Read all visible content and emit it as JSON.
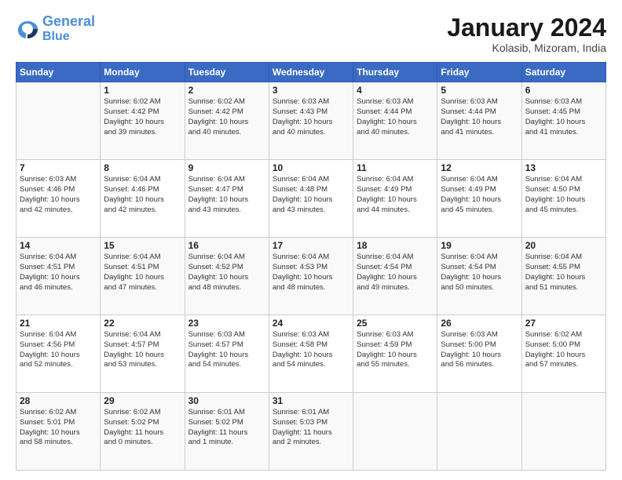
{
  "logo": {
    "line1": "General",
    "line2": "Blue"
  },
  "title": "January 2024",
  "location": "Kolasib, Mizoram, India",
  "weekdays": [
    "Sunday",
    "Monday",
    "Tuesday",
    "Wednesday",
    "Thursday",
    "Friday",
    "Saturday"
  ],
  "weeks": [
    [
      {
        "day": "",
        "info": ""
      },
      {
        "day": "1",
        "info": "Sunrise: 6:02 AM\nSunset: 4:42 PM\nDaylight: 10 hours\nand 39 minutes."
      },
      {
        "day": "2",
        "info": "Sunrise: 6:02 AM\nSunset: 4:42 PM\nDaylight: 10 hours\nand 40 minutes."
      },
      {
        "day": "3",
        "info": "Sunrise: 6:03 AM\nSunset: 4:43 PM\nDaylight: 10 hours\nand 40 minutes."
      },
      {
        "day": "4",
        "info": "Sunrise: 6:03 AM\nSunset: 4:44 PM\nDaylight: 10 hours\nand 40 minutes."
      },
      {
        "day": "5",
        "info": "Sunrise: 6:03 AM\nSunset: 4:44 PM\nDaylight: 10 hours\nand 41 minutes."
      },
      {
        "day": "6",
        "info": "Sunrise: 6:03 AM\nSunset: 4:45 PM\nDaylight: 10 hours\nand 41 minutes."
      }
    ],
    [
      {
        "day": "7",
        "info": "Sunrise: 6:03 AM\nSunset: 4:46 PM\nDaylight: 10 hours\nand 42 minutes."
      },
      {
        "day": "8",
        "info": "Sunrise: 6:04 AM\nSunset: 4:46 PM\nDaylight: 10 hours\nand 42 minutes."
      },
      {
        "day": "9",
        "info": "Sunrise: 6:04 AM\nSunset: 4:47 PM\nDaylight: 10 hours\nand 43 minutes."
      },
      {
        "day": "10",
        "info": "Sunrise: 6:04 AM\nSunset: 4:48 PM\nDaylight: 10 hours\nand 43 minutes."
      },
      {
        "day": "11",
        "info": "Sunrise: 6:04 AM\nSunset: 4:49 PM\nDaylight: 10 hours\nand 44 minutes."
      },
      {
        "day": "12",
        "info": "Sunrise: 6:04 AM\nSunset: 4:49 PM\nDaylight: 10 hours\nand 45 minutes."
      },
      {
        "day": "13",
        "info": "Sunrise: 6:04 AM\nSunset: 4:50 PM\nDaylight: 10 hours\nand 45 minutes."
      }
    ],
    [
      {
        "day": "14",
        "info": "Sunrise: 6:04 AM\nSunset: 4:51 PM\nDaylight: 10 hours\nand 46 minutes."
      },
      {
        "day": "15",
        "info": "Sunrise: 6:04 AM\nSunset: 4:51 PM\nDaylight: 10 hours\nand 47 minutes."
      },
      {
        "day": "16",
        "info": "Sunrise: 6:04 AM\nSunset: 4:52 PM\nDaylight: 10 hours\nand 48 minutes."
      },
      {
        "day": "17",
        "info": "Sunrise: 6:04 AM\nSunset: 4:53 PM\nDaylight: 10 hours\nand 48 minutes."
      },
      {
        "day": "18",
        "info": "Sunrise: 6:04 AM\nSunset: 4:54 PM\nDaylight: 10 hours\nand 49 minutes."
      },
      {
        "day": "19",
        "info": "Sunrise: 6:04 AM\nSunset: 4:54 PM\nDaylight: 10 hours\nand 50 minutes."
      },
      {
        "day": "20",
        "info": "Sunrise: 6:04 AM\nSunset: 4:55 PM\nDaylight: 10 hours\nand 51 minutes."
      }
    ],
    [
      {
        "day": "21",
        "info": "Sunrise: 6:04 AM\nSunset: 4:56 PM\nDaylight: 10 hours\nand 52 minutes."
      },
      {
        "day": "22",
        "info": "Sunrise: 6:04 AM\nSunset: 4:57 PM\nDaylight: 10 hours\nand 53 minutes."
      },
      {
        "day": "23",
        "info": "Sunrise: 6:03 AM\nSunset: 4:57 PM\nDaylight: 10 hours\nand 54 minutes."
      },
      {
        "day": "24",
        "info": "Sunrise: 6:03 AM\nSunset: 4:58 PM\nDaylight: 10 hours\nand 54 minutes."
      },
      {
        "day": "25",
        "info": "Sunrise: 6:03 AM\nSunset: 4:59 PM\nDaylight: 10 hours\nand 55 minutes."
      },
      {
        "day": "26",
        "info": "Sunrise: 6:03 AM\nSunset: 5:00 PM\nDaylight: 10 hours\nand 56 minutes."
      },
      {
        "day": "27",
        "info": "Sunrise: 6:02 AM\nSunset: 5:00 PM\nDaylight: 10 hours\nand 57 minutes."
      }
    ],
    [
      {
        "day": "28",
        "info": "Sunrise: 6:02 AM\nSunset: 5:01 PM\nDaylight: 10 hours\nand 58 minutes."
      },
      {
        "day": "29",
        "info": "Sunrise: 6:02 AM\nSunset: 5:02 PM\nDaylight: 11 hours\nand 0 minutes."
      },
      {
        "day": "30",
        "info": "Sunrise: 6:01 AM\nSunset: 5:02 PM\nDaylight: 11 hours\nand 1 minute."
      },
      {
        "day": "31",
        "info": "Sunrise: 6:01 AM\nSunset: 5:03 PM\nDaylight: 11 hours\nand 2 minutes."
      },
      {
        "day": "",
        "info": ""
      },
      {
        "day": "",
        "info": ""
      },
      {
        "day": "",
        "info": ""
      }
    ]
  ]
}
